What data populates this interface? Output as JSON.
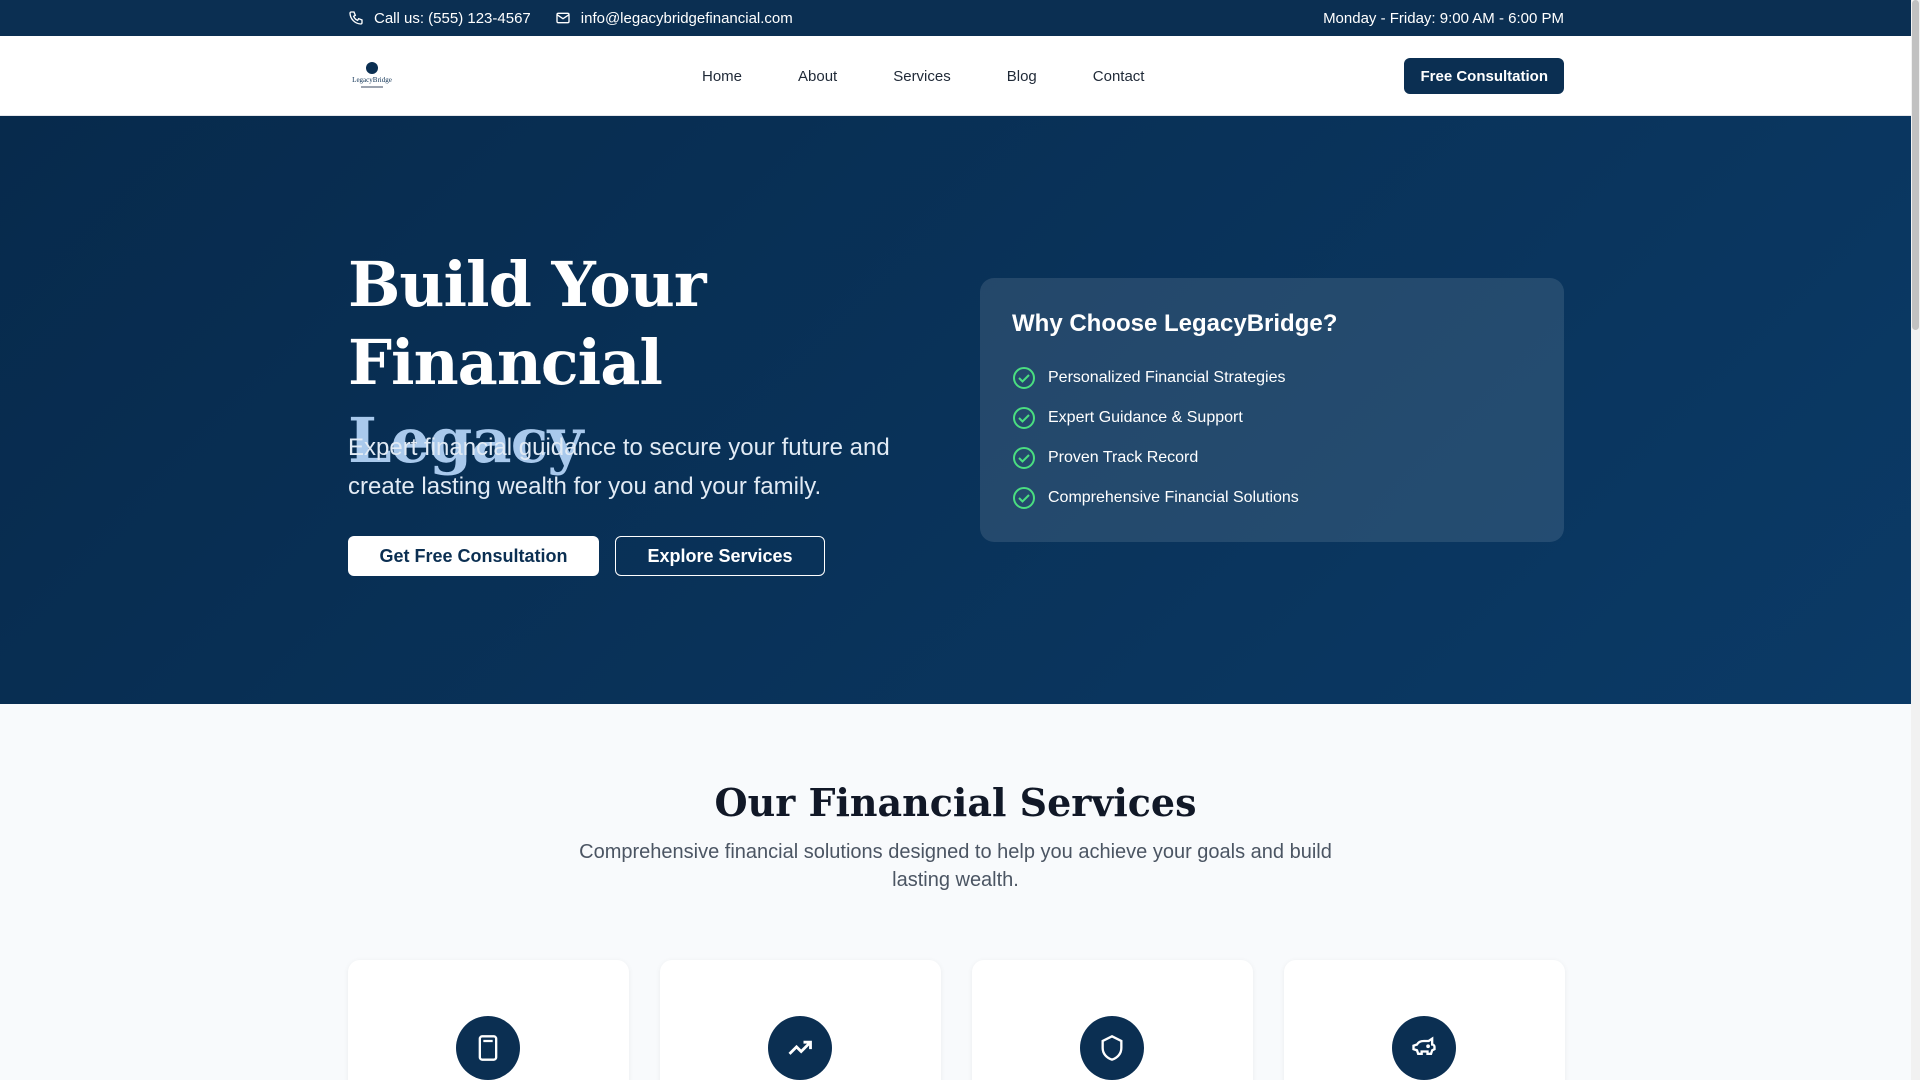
{
  "topbar": {
    "phone": "Call us: (555) 123-4567",
    "email": "info@legacybridgefinancial.com",
    "hours": "Monday - Friday: 9:00 AM - 6:00 PM"
  },
  "nav": {
    "logo_text": "LegacyBridge",
    "links": [
      "Home",
      "About",
      "Services",
      "Blog",
      "Contact"
    ],
    "cta": "Free Consultation"
  },
  "hero": {
    "title_line1": "Build Your Financial",
    "title_line2": "Legacy",
    "subtitle": "Expert financial guidance to secure your future and create lasting wealth for you and your family.",
    "primary_button": "Get Free Consultation",
    "secondary_button": "Explore Services"
  },
  "why": {
    "title": "Why Choose LegacyBridge?",
    "items": [
      "Personalized Financial Strategies",
      "Expert Guidance & Support",
      "Proven Track Record",
      "Comprehensive Financial Solutions"
    ]
  },
  "services": {
    "title": "Our Financial Services",
    "subtitle": "Comprehensive financial solutions designed to help you achieve your goals and build lasting wealth.",
    "icons": [
      "calculator-icon",
      "trending-up-icon",
      "shield-icon",
      "piggy-bank-icon"
    ]
  },
  "colors": {
    "primary": "#0b2f52",
    "accent": "#a9c9ec",
    "check": "#4ade80"
  }
}
